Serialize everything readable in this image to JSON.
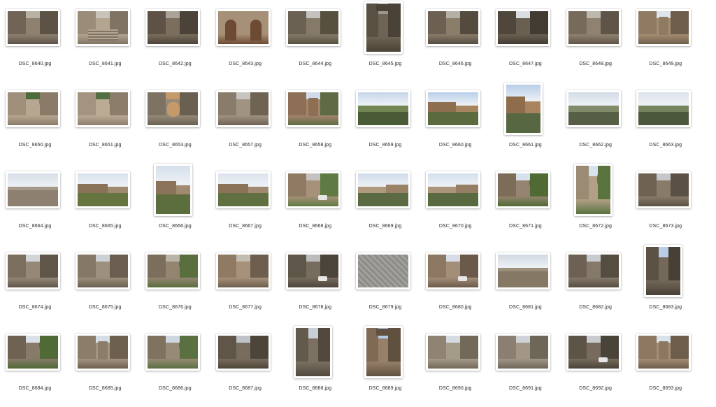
{
  "window": {
    "view": "icon-view"
  },
  "files": [
    {
      "name": "DSC_8640.jpg",
      "orientation": "landscape",
      "scene": "alley",
      "palette": [
        "#6f6455",
        "#8e8170",
        "#5c5246",
        "#b7b1a6"
      ]
    },
    {
      "name": "DSC_8641.jpg",
      "orientation": "landscape",
      "scene": "stairs",
      "palette": [
        "#9a8c79",
        "#b3a58f",
        "#7f7363",
        "#c9c4ba"
      ]
    },
    {
      "name": "DSC_8642.jpg",
      "orientation": "landscape",
      "scene": "alley",
      "palette": [
        "#5d5245",
        "#7b6e5d",
        "#4b4338",
        "#a9a398"
      ]
    },
    {
      "name": "DSC_8643.jpg",
      "orientation": "landscape",
      "scene": "doors",
      "palette": [
        "#8a7863",
        "#a69077",
        "#6d4a32",
        "#b9ab98"
      ]
    },
    {
      "name": "DSC_8644.jpg",
      "orientation": "landscape",
      "scene": "alley",
      "palette": [
        "#6a6153",
        "#857a69",
        "#57503f",
        "#c3c2bf"
      ]
    },
    {
      "name": "DSC_8645.jpg",
      "orientation": "portrait",
      "scene": "arch",
      "palette": [
        "#5a5044",
        "#6e6354",
        "#4a4237",
        "#9c978f"
      ]
    },
    {
      "name": "DSC_8646.jpg",
      "orientation": "landscape",
      "scene": "alley",
      "palette": [
        "#6b6052",
        "#8a7d6a",
        "#544b3f",
        "#b4b0a8"
      ]
    },
    {
      "name": "DSC_8647.jpg",
      "orientation": "landscape",
      "scene": "alley",
      "palette": [
        "#4f473c",
        "#6a6051",
        "#423b32",
        "#d9dde2"
      ]
    },
    {
      "name": "DSC_8648.jpg",
      "orientation": "landscape",
      "scene": "alley",
      "palette": [
        "#766a5a",
        "#8f8270",
        "#5e5447",
        "#bdb8ae"
      ]
    },
    {
      "name": "DSC_8649.jpg",
      "orientation": "landscape",
      "scene": "church",
      "palette": [
        "#8f7a62",
        "#a58d70",
        "#6e5d4b",
        "#dfe4ea"
      ]
    },
    {
      "name": "DSC_8650.jpg",
      "orientation": "landscape",
      "scene": "courtyard",
      "palette": [
        "#a08f7a",
        "#b8a790",
        "#8a7b69",
        "#4d6a3a"
      ]
    },
    {
      "name": "DSC_8651.jpg",
      "orientation": "landscape",
      "scene": "courtyard",
      "palette": [
        "#a39380",
        "#bbab95",
        "#8c7d6b",
        "#546f3f"
      ]
    },
    {
      "name": "DSC_8653.jpg",
      "orientation": "landscape",
      "scene": "cat",
      "palette": [
        "#7e7262",
        "#968a78",
        "#6a6052",
        "#c49a6a"
      ]
    },
    {
      "name": "DSC_8657.jpg",
      "orientation": "landscape",
      "scene": "alley",
      "palette": [
        "#8a7c6a",
        "#a19381",
        "#6f6354",
        "#c8c5bf"
      ]
    },
    {
      "name": "DSC_8658.jpg",
      "orientation": "landscape",
      "scene": "building",
      "palette": [
        "#8c6f55",
        "#a3856a",
        "#5f6b45",
        "#cfdbe8"
      ]
    },
    {
      "name": "DSC_8659.jpg",
      "orientation": "landscape",
      "scene": "valley",
      "palette": [
        "#5d7044",
        "#728654",
        "#4a5a37",
        "#c6d6ea"
      ]
    },
    {
      "name": "DSC_8660.jpg",
      "orientation": "landscape",
      "scene": "cliff",
      "palette": [
        "#8d6e4f",
        "#a6855f",
        "#5b6a3f",
        "#b9d0ea"
      ]
    },
    {
      "name": "DSC_8661.jpg",
      "orientation": "portrait",
      "scene": "tower",
      "palette": [
        "#8f6c4c",
        "#a98460",
        "#576742",
        "#b8cde8"
      ]
    },
    {
      "name": "DSC_8662.jpg",
      "orientation": "landscape",
      "scene": "valley",
      "palette": [
        "#6b7456",
        "#818a69",
        "#565e45",
        "#d2dbe5"
      ]
    },
    {
      "name": "DSC_8663.jpg",
      "orientation": "landscape",
      "scene": "valley",
      "palette": [
        "#5f6d4a",
        "#76845d",
        "#4c583b",
        "#dbe3ec"
      ]
    },
    {
      "name": "DSC_8664.jpg",
      "orientation": "landscape",
      "scene": "wall-road",
      "palette": [
        "#8d8071",
        "#a59888",
        "#6d6256",
        "#d7dee7"
      ]
    },
    {
      "name": "DSC_8665.jpg",
      "orientation": "landscape",
      "scene": "town",
      "palette": [
        "#8a7259",
        "#a08870",
        "#66743f",
        "#d9e2ec"
      ]
    },
    {
      "name": "DSC_8666.jpg",
      "orientation": "portrait",
      "scene": "town",
      "palette": [
        "#8b735b",
        "#a28a71",
        "#5d6e3e",
        "#d5dfea"
      ]
    },
    {
      "name": "DSC_8667.jpg",
      "orientation": "landscape",
      "scene": "town",
      "palette": [
        "#8b735a",
        "#a18970",
        "#617041",
        "#dbe3ec"
      ]
    },
    {
      "name": "DSC_8668.jpg",
      "orientation": "landscape",
      "scene": "street-car",
      "palette": [
        "#8f7b63",
        "#a6917a",
        "#5f7a42",
        "#c4c2be"
      ]
    },
    {
      "name": "DSC_8669.jpg",
      "orientation": "landscape",
      "scene": "castle",
      "palette": [
        "#998266",
        "#b09a7d",
        "#5c6a44",
        "#cfdcea"
      ]
    },
    {
      "name": "DSC_8670.jpg",
      "orientation": "landscape",
      "scene": "castle",
      "palette": [
        "#957e63",
        "#ab947a",
        "#5a6a40",
        "#d3dfec"
      ]
    },
    {
      "name": "DSC_8671.jpg",
      "orientation": "landscape",
      "scene": "trees-house",
      "palette": [
        "#7d6d58",
        "#948470",
        "#4f6a33",
        "#d6e1ec"
      ]
    },
    {
      "name": "DSC_8672.jpg",
      "orientation": "portrait",
      "scene": "house",
      "palette": [
        "#9b8a74",
        "#b39f86",
        "#5a7440",
        "#d8e2ec"
      ]
    },
    {
      "name": "DSC_8673.jpg",
      "orientation": "landscape",
      "scene": "alley",
      "palette": [
        "#6e6253",
        "#887b69",
        "#5a5043",
        "#c6c7c8"
      ]
    },
    {
      "name": "DSC_8674.jpg",
      "orientation": "landscape",
      "scene": "alley",
      "palette": [
        "#7b6f60",
        "#958877",
        "#5f5548",
        "#d3d5d8"
      ]
    },
    {
      "name": "DSC_8675.jpg",
      "orientation": "landscape",
      "scene": "alley",
      "palette": [
        "#857866",
        "#9d907c",
        "#695e50",
        "#cdd1d6"
      ]
    },
    {
      "name": "DSC_8676.jpg",
      "orientation": "landscape",
      "scene": "alley-green",
      "palette": [
        "#7c6e5c",
        "#948571",
        "#5a6e3e",
        "#b9b3a8"
      ]
    },
    {
      "name": "DSC_8677.jpg",
      "orientation": "landscape",
      "scene": "alley",
      "palette": [
        "#8f7a63",
        "#a7917a",
        "#6d5e4d",
        "#c4bcb0"
      ]
    },
    {
      "name": "DSC_8678.jpg",
      "orientation": "landscape",
      "scene": "alley-car",
      "palette": [
        "#5f564a",
        "#776c5e",
        "#4b443a",
        "#bcbcba"
      ]
    },
    {
      "name": "DSC_8679.jpg",
      "orientation": "landscape",
      "scene": "cobbles",
      "palette": [
        "#8e8c88",
        "#a3a19d",
        "#7a7874",
        "#8e8c88"
      ]
    },
    {
      "name": "DSC_8680.jpg",
      "orientation": "landscape",
      "scene": "street-car",
      "palette": [
        "#8c7763",
        "#a38e79",
        "#6b5a49",
        "#d6dde6"
      ]
    },
    {
      "name": "DSC_8681.jpg",
      "orientation": "landscape",
      "scene": "wall-road",
      "palette": [
        "#857865",
        "#9c8f7c",
        "#66743f",
        "#d2d9e2"
      ]
    },
    {
      "name": "DSC_8682.jpg",
      "orientation": "landscape",
      "scene": "alley",
      "palette": [
        "#6c6152",
        "#85796a",
        "#564d41",
        "#c8cbcf"
      ]
    },
    {
      "name": "DSC_8683.jpg",
      "orientation": "portrait",
      "scene": "alley",
      "palette": [
        "#5b5145",
        "#73685a",
        "#483f35",
        "#b9cde6"
      ]
    },
    {
      "name": "DSC_8684.jpg",
      "orientation": "landscape",
      "scene": "alley-green",
      "palette": [
        "#6e6252",
        "#877a68",
        "#4f6a35",
        "#d9e0e9"
      ]
    },
    {
      "name": "DSC_8685.jpg",
      "orientation": "landscape",
      "scene": "building",
      "palette": [
        "#8c7d6a",
        "#a39480",
        "#6d604f",
        "#d5dde7"
      ]
    },
    {
      "name": "DSC_8686.jpg",
      "orientation": "landscape",
      "scene": "alley-green",
      "palette": [
        "#7f725f",
        "#978a76",
        "#5a7040",
        "#cdd6e1"
      ]
    },
    {
      "name": "DSC_8687.jpg",
      "orientation": "landscape",
      "scene": "alley",
      "palette": [
        "#5f5548",
        "#776c5d",
        "#4d453a",
        "#bfc3c8"
      ]
    },
    {
      "name": "DSC_8688.jpg",
      "orientation": "portrait",
      "scene": "alley",
      "palette": [
        "#635a4d",
        "#7b7061",
        "#51493e",
        "#c9cfd6"
      ]
    },
    {
      "name": "DSC_8689.jpg",
      "orientation": "portrait",
      "scene": "tower-alley",
      "palette": [
        "#7e6a55",
        "#96806a",
        "#5f5040",
        "#b3cbe9"
      ]
    },
    {
      "name": "DSC_8690.jpg",
      "orientation": "landscape",
      "scene": "street",
      "palette": [
        "#8f8474",
        "#a69a89",
        "#736958",
        "#d5dbe2"
      ]
    },
    {
      "name": "DSC_8691.jpg",
      "orientation": "landscape",
      "scene": "alley",
      "palette": [
        "#8a7f70",
        "#a29686",
        "#6f665a",
        "#cfd3d8"
      ]
    },
    {
      "name": "DSC_8692.jpg",
      "orientation": "landscape",
      "scene": "street-car",
      "palette": [
        "#5d5448",
        "#766b5c",
        "#4a4339",
        "#c9cbce"
      ]
    },
    {
      "name": "DSC_8693.jpg",
      "orientation": "landscape",
      "scene": "church",
      "palette": [
        "#8e7760",
        "#a58e76",
        "#6e5d4b",
        "#d9e1ea"
      ]
    }
  ]
}
